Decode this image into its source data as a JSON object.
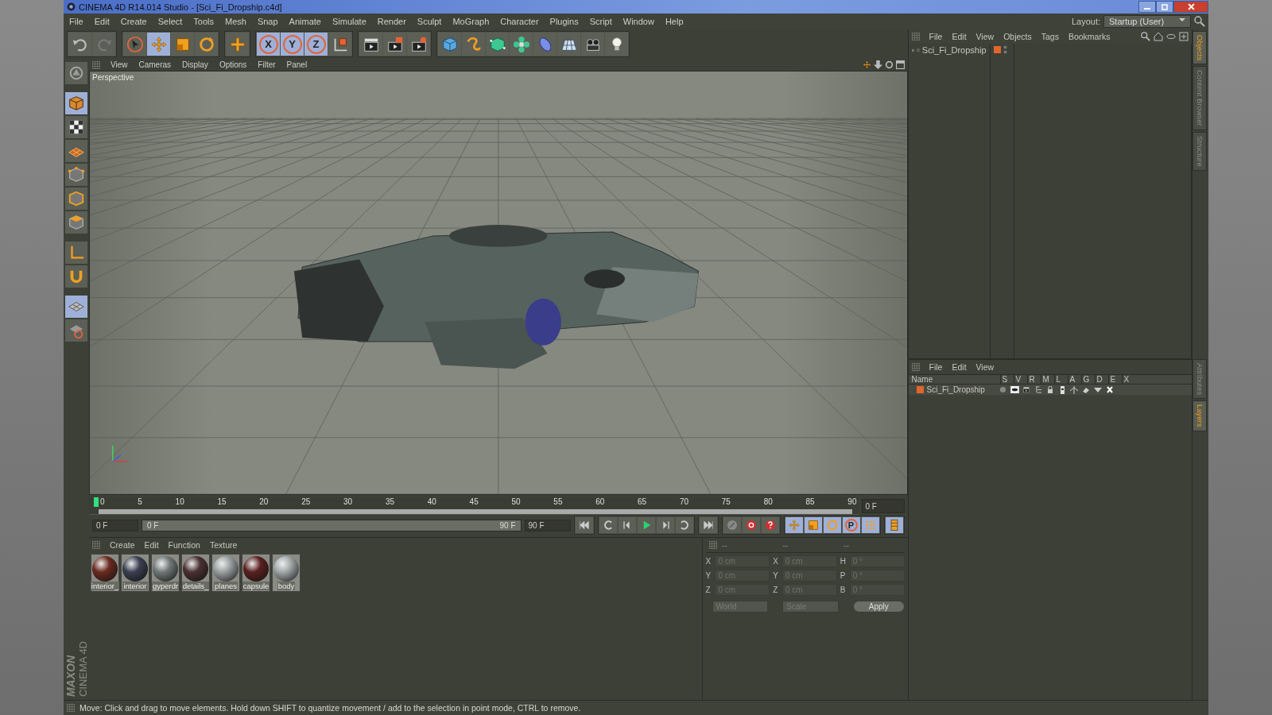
{
  "window": {
    "title": "CINEMA 4D R14.014 Studio - [Sci_Fi_Dropship.c4d]"
  },
  "menu": [
    "File",
    "Edit",
    "Create",
    "Select",
    "Tools",
    "Mesh",
    "Snap",
    "Animate",
    "Simulate",
    "Render",
    "Sculpt",
    "MoGraph",
    "Character",
    "Plugins",
    "Script",
    "Window",
    "Help"
  ],
  "layout": {
    "label": "Layout:",
    "value": "Startup (User)"
  },
  "toolbar_groups": [
    [
      {
        "kind": "undo",
        "selected": false
      },
      {
        "kind": "redo",
        "selected": false
      }
    ],
    [
      {
        "kind": "select",
        "selected": false
      },
      {
        "kind": "move",
        "selected": true
      },
      {
        "kind": "scale",
        "selected": false
      },
      {
        "kind": "rotate",
        "selected": false
      }
    ],
    [
      {
        "kind": "add",
        "selected": false
      }
    ],
    [
      {
        "kind": "axis",
        "label": "X",
        "selected": true
      },
      {
        "kind": "axis",
        "label": "Y",
        "selected": true
      },
      {
        "kind": "axis",
        "label": "Z",
        "selected": true
      },
      {
        "kind": "coords",
        "selected": false
      }
    ],
    [
      {
        "kind": "render-view",
        "selected": false
      },
      {
        "kind": "render",
        "selected": false
      },
      {
        "kind": "render-settings",
        "selected": false
      }
    ],
    [
      {
        "kind": "cube",
        "selected": false
      },
      {
        "kind": "spline",
        "selected": false
      },
      {
        "kind": "nurbs",
        "selected": false
      },
      {
        "kind": "array",
        "selected": false
      },
      {
        "kind": "deformer",
        "selected": false
      },
      {
        "kind": "floor",
        "selected": false
      },
      {
        "kind": "camera",
        "selected": false
      },
      {
        "kind": "light",
        "selected": false
      }
    ]
  ],
  "left_toolbar": [
    {
      "kind": "model",
      "selected": false
    },
    {
      "kind": "object-mode",
      "selected": true
    },
    {
      "kind": "texture",
      "selected": false
    },
    {
      "kind": "workplane",
      "selected": false
    },
    {
      "kind": "points",
      "selected": false
    },
    {
      "kind": "edges",
      "selected": false
    },
    {
      "kind": "polygons",
      "selected": false
    },
    {
      "kind": "axis-mode",
      "selected": false
    },
    {
      "kind": "magnet",
      "selected": false
    },
    {
      "kind": "snap",
      "selected": true
    },
    {
      "kind": "grid",
      "selected": false
    }
  ],
  "viewport": {
    "menu": [
      "View",
      "Cameras",
      "Display",
      "Options",
      "Filter",
      "Panel"
    ],
    "label": "Perspective"
  },
  "timeline": {
    "labels": [
      "0",
      "5",
      "10",
      "15",
      "20",
      "25",
      "30",
      "35",
      "40",
      "45",
      "50",
      "55",
      "60",
      "65",
      "70",
      "75",
      "80",
      "85",
      "90"
    ],
    "playhead": {
      "level": 0
    },
    "frame_field": "0 F"
  },
  "time_controls": {
    "start_field": "0 F",
    "range": {
      "start": "0 F",
      "end": "90 F",
      "level": 1
    },
    "end_field": "90 F",
    "transport": [
      {
        "kind": "skip-start"
      },
      {
        "kind": "prev-key"
      },
      {
        "kind": "step-back"
      },
      {
        "kind": "play"
      },
      {
        "kind": "step-forward"
      },
      {
        "kind": "next-key"
      },
      {
        "kind": "skip-end"
      }
    ],
    "record": [
      {
        "kind": "keyframe"
      },
      {
        "kind": "record"
      },
      {
        "kind": "help"
      }
    ],
    "keys": [
      {
        "kind": "move",
        "selected": true
      },
      {
        "kind": "scale",
        "selected": true
      },
      {
        "kind": "rotate",
        "selected": true
      },
      {
        "kind": "param",
        "label": "P",
        "selected": true
      },
      {
        "kind": "dots",
        "selected": true
      }
    ],
    "timeline_button": {
      "selected": true
    }
  },
  "materials": {
    "menu": [
      "Create",
      "Edit",
      "Function",
      "Texture"
    ],
    "items": [
      "interior_",
      "interior",
      "gyperdr",
      "details_",
      "planes",
      "capsule",
      "body"
    ]
  },
  "coordinates": {
    "headers": [
      "--",
      "--",
      "--"
    ],
    "rows": [
      {
        "axes": [
          "X",
          "X",
          "H"
        ],
        "values": [
          "0 cm",
          "0 cm",
          "0 °"
        ]
      },
      {
        "axes": [
          "Y",
          "Y",
          "P"
        ],
        "values": [
          "0 cm",
          "0 cm",
          "0 °"
        ]
      },
      {
        "axes": [
          "Z",
          "Z",
          "B"
        ],
        "values": [
          "0 cm",
          "0 cm",
          "0 °"
        ]
      }
    ],
    "dropdowns": [
      "World",
      "Scale"
    ],
    "apply": "Apply"
  },
  "object_manager": {
    "menu": [
      "File",
      "Edit",
      "View",
      "Objects",
      "Tags",
      "Bookmarks"
    ],
    "objects": [
      {
        "name": "Sci_Fi_Dropship",
        "expanded": false,
        "color": "#e0662c"
      }
    ]
  },
  "layer_manager": {
    "menu": [
      "File",
      "Edit",
      "View"
    ],
    "columns": [
      "Name",
      "S",
      "V",
      "R",
      "M",
      "L",
      "A",
      "G",
      "D",
      "E",
      "X"
    ],
    "layers": [
      {
        "name": "Sci_Fi_Dropship",
        "color": "#e0662c"
      }
    ]
  },
  "side_tabs": {
    "top": [
      {
        "label": "Objects",
        "selected": true
      },
      {
        "label": "Content Browser",
        "selected": false
      },
      {
        "label": "Structure",
        "selected": false
      }
    ],
    "bottom": [
      {
        "label": "Attributes",
        "selected": false
      },
      {
        "label": "Layers",
        "selected": true
      }
    ]
  },
  "branding": {
    "maxon": "MAXON",
    "product": "CINEMA 4D"
  },
  "status_bar": "Move: Click and drag to move elements. Hold down SHIFT to quantize movement / add to the selection in point mode, CTRL to remove."
}
